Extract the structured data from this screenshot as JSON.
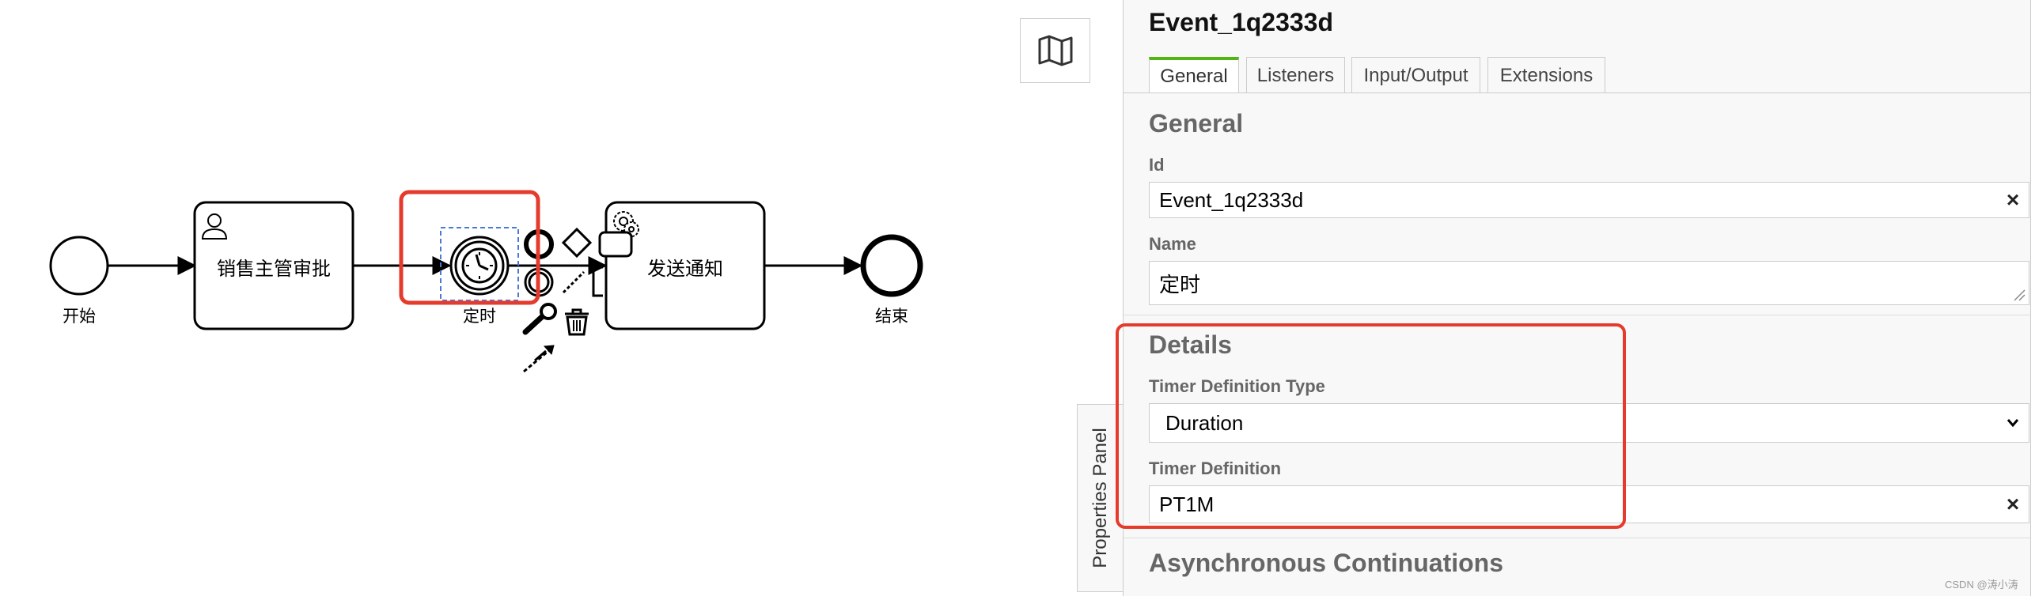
{
  "diagram": {
    "start_label": "开始",
    "task1_label": "销售主管审批",
    "timer_label": "定时",
    "task2_label": "发送通知",
    "end_label": "结束",
    "highlight_color": "#e53b2c"
  },
  "toolbar": {
    "map_icon": "map-icon"
  },
  "properties_toggle_label": "Properties Panel",
  "panel": {
    "title": "Event_1q2333d",
    "tabs": [
      "General",
      "Listeners",
      "Input/Output",
      "Extensions"
    ],
    "active_tab": "General",
    "general": {
      "heading": "General",
      "id_label": "Id",
      "id_value": "Event_1q2333d",
      "name_label": "Name",
      "name_value": "定时"
    },
    "details": {
      "heading": "Details",
      "timer_type_label": "Timer Definition Type",
      "timer_type_value": "Duration",
      "timer_def_label": "Timer Definition",
      "timer_def_value": "PT1M"
    },
    "async_heading": "Asynchronous Continuations",
    "clear_symbol": "×"
  },
  "watermark": "CSDN @涛小涛"
}
